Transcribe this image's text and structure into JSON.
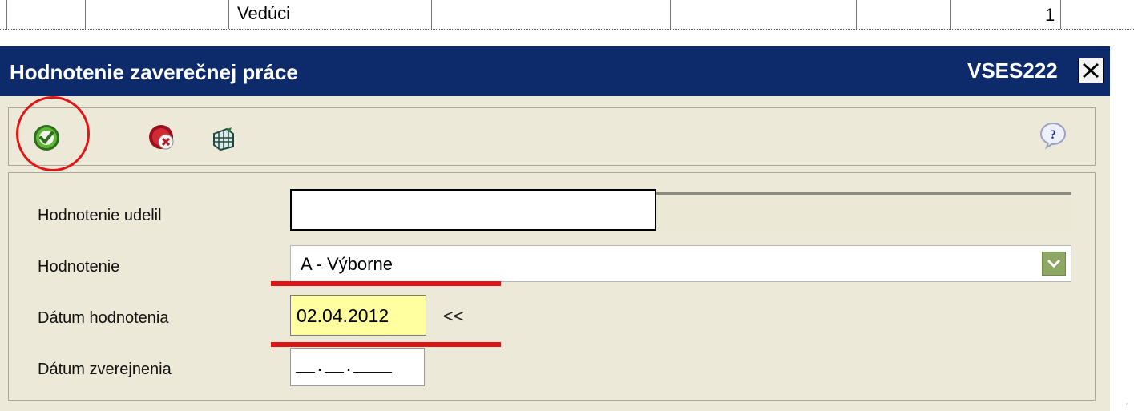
{
  "table_row": {
    "role_label": "Vedúci",
    "count": "1"
  },
  "dialog": {
    "title": "Hodnotenie zaverečnej práce",
    "code": "VSES222"
  },
  "toolbar": {
    "confirm_icon": "green-check-icon",
    "cancel_icon": "red-x-icon",
    "grid_icon": "table-grid-icon",
    "help_icon": "help-question-icon"
  },
  "form": {
    "awarded_by_label": "Hodnotenie udelil",
    "awarded_by_value": "",
    "grade_label": "Hodnotenie",
    "grade_value": "A - Výborne",
    "eval_date_label": "Dátum hodnotenia",
    "eval_date_value": "02.04.2012",
    "date_picker_label": "<<",
    "pub_date_label": "Dátum zverejnenia",
    "pub_date_value": "__.__.____"
  },
  "colors": {
    "titlebar": "#0d2a6b",
    "panel": "#ece9d8",
    "highlight_field": "#ffff9f",
    "annotation_red": "#e11515"
  }
}
